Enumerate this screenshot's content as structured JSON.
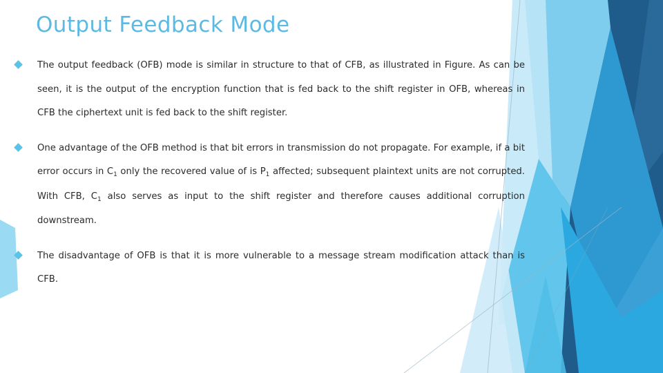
{
  "slide": {
    "title": "Output Feedback Mode",
    "title_color": "#5CB9E4",
    "background_color": "#FFFFFF",
    "body_text_color": "#2B2B2B",
    "bullet_glyph": "diamond",
    "bullet_color": "#58C4E8"
  },
  "body": {
    "paragraphs": [
      {
        "bullet": "diamond",
        "text": "The output feedback (OFB) mode is similar in structure to that of CFB, as illustrated in Figure. As can be seen, it is the output of the encryption function that is fed back to the shift register in OFB, whereas in CFB the ciphertext unit is fed back to the shift register."
      },
      {
        "bullet": "diamond",
        "part1": "One advantage of the OFB method is that bit errors in transmission do not propagate. For example, if a bit error occurs in C",
        "sub1": "1",
        "part2": " only the recovered value of is P",
        "sub2": "1",
        "part3": " affected; subsequent plaintext units are not corrupted. With CFB, C",
        "sub3": "1",
        "part4": " also serves as input to the shift register and therefore causes additional corruption downstream."
      },
      {
        "bullet": "diamond",
        "text": "The disadvantage of OFB is that it is more vulnerable to a message stream modification attack than is CFB."
      }
    ]
  },
  "decoration": {
    "name": "facet-theme-angular-blue-graphic",
    "palette": {
      "pale_ice": "#D5EEF9",
      "light_sky": "#8ED7F2",
      "sky": "#6FC9EC",
      "mid_blue": "#41B6E6",
      "azure": "#29ABE2",
      "ocean": "#2E8FC6",
      "steel": "#2E6E9E",
      "deep_navy": "#1F5C8B",
      "hairline": "#9BB8C7"
    }
  }
}
